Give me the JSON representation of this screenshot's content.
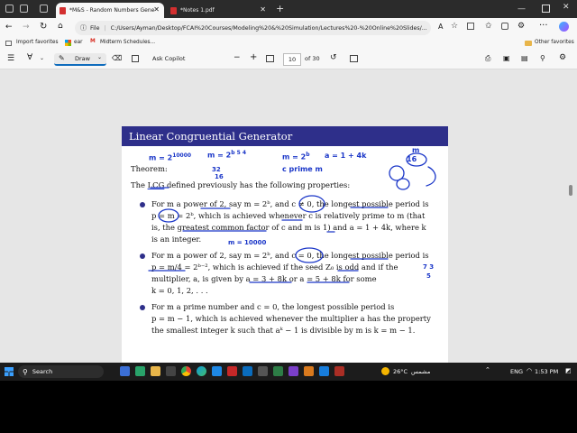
{
  "browser": {
    "tabs": [
      {
        "label": "*M&S - Random Numbers Gene",
        "active": true
      },
      {
        "label": "*Notes 1.pdf",
        "active": false
      }
    ],
    "new_tab": "+",
    "file_label": "File",
    "url": "C:/Users/Ayman/Desktop/FCAI%20Courses/Modeling%20&%20Simulation/Lectures%20-%20Online%20Slides/...",
    "favorites": {
      "import": "Import favorites",
      "ear": "ear",
      "midterm": "Midterm Schedules...",
      "other": "Other favorites"
    }
  },
  "pdf_toolbar": {
    "draw": "Draw",
    "ask_copilot": "Ask Copilot",
    "zoom_out": "−",
    "zoom_in": "+",
    "page": "10",
    "page_of": "of 30"
  },
  "slide": {
    "title": "Linear Congruential Generator",
    "theorem": "Theorem:",
    "intro_prefix": "The ",
    "intro_lcg": "LCG",
    "intro_rest": " defined previously has the following properties:",
    "b1_l1": "For m a power of 2, say m = 2ᵇ, and c ≠ 0, the longest possible period is",
    "b1_l2": "p = m = 2ᵇ, which is achieved whenever c is relatively prime to m (that",
    "b1_l3": "is, the greatest common factor of c and m is 1) and a = 1 + 4k, where k",
    "b1_l4": "is an integer.",
    "b2_l1": "For m a power of 2, say m = 2ᵇ, and c = 0, the longest possible period is",
    "b2_l2": "p = m/4 = 2ᵇ⁻², which is achieved if the seed Z₀ is odd and if the",
    "b2_l3": "multiplier, a, is given by a = 3 + 8k or a = 5 + 8k for some",
    "b2_l4": "k = 0, 1, 2, . . .",
    "b3_l1": "For m a prime number and c = 0, the longest possible period is",
    "b3_l2": "p = m − 1, which is achieved whenever the multiplier a has the property",
    "b3_l3": "the smallest integer k such that aᵏ − 1 is divisible by m is k = m − 1."
  },
  "annotations": {
    "a1": "m = 2",
    "a1_exp": "10000",
    "a2": "m = 2",
    "a2_exp": "b 5 4",
    "a3": "32",
    "a4": "16",
    "a5": "m = 2",
    "a5_exp": "b",
    "a6": "a = 1 + 4k",
    "a7": "c prime m",
    "a8": "m = 10000",
    "a9": "m",
    "a10": "16",
    "a11": "7 3",
    "a12": "5"
  },
  "taskbar": {
    "search": "Search",
    "weather": "26°C",
    "weather_desc": "مشمس",
    "lang": "ENG",
    "time": "1:53 PM"
  },
  "colors": {
    "title_bar": "#2e2f8a",
    "ink": "#1a36c8",
    "tab_bar": "#2b2b2b",
    "taskbar": "#1c1c1c"
  }
}
